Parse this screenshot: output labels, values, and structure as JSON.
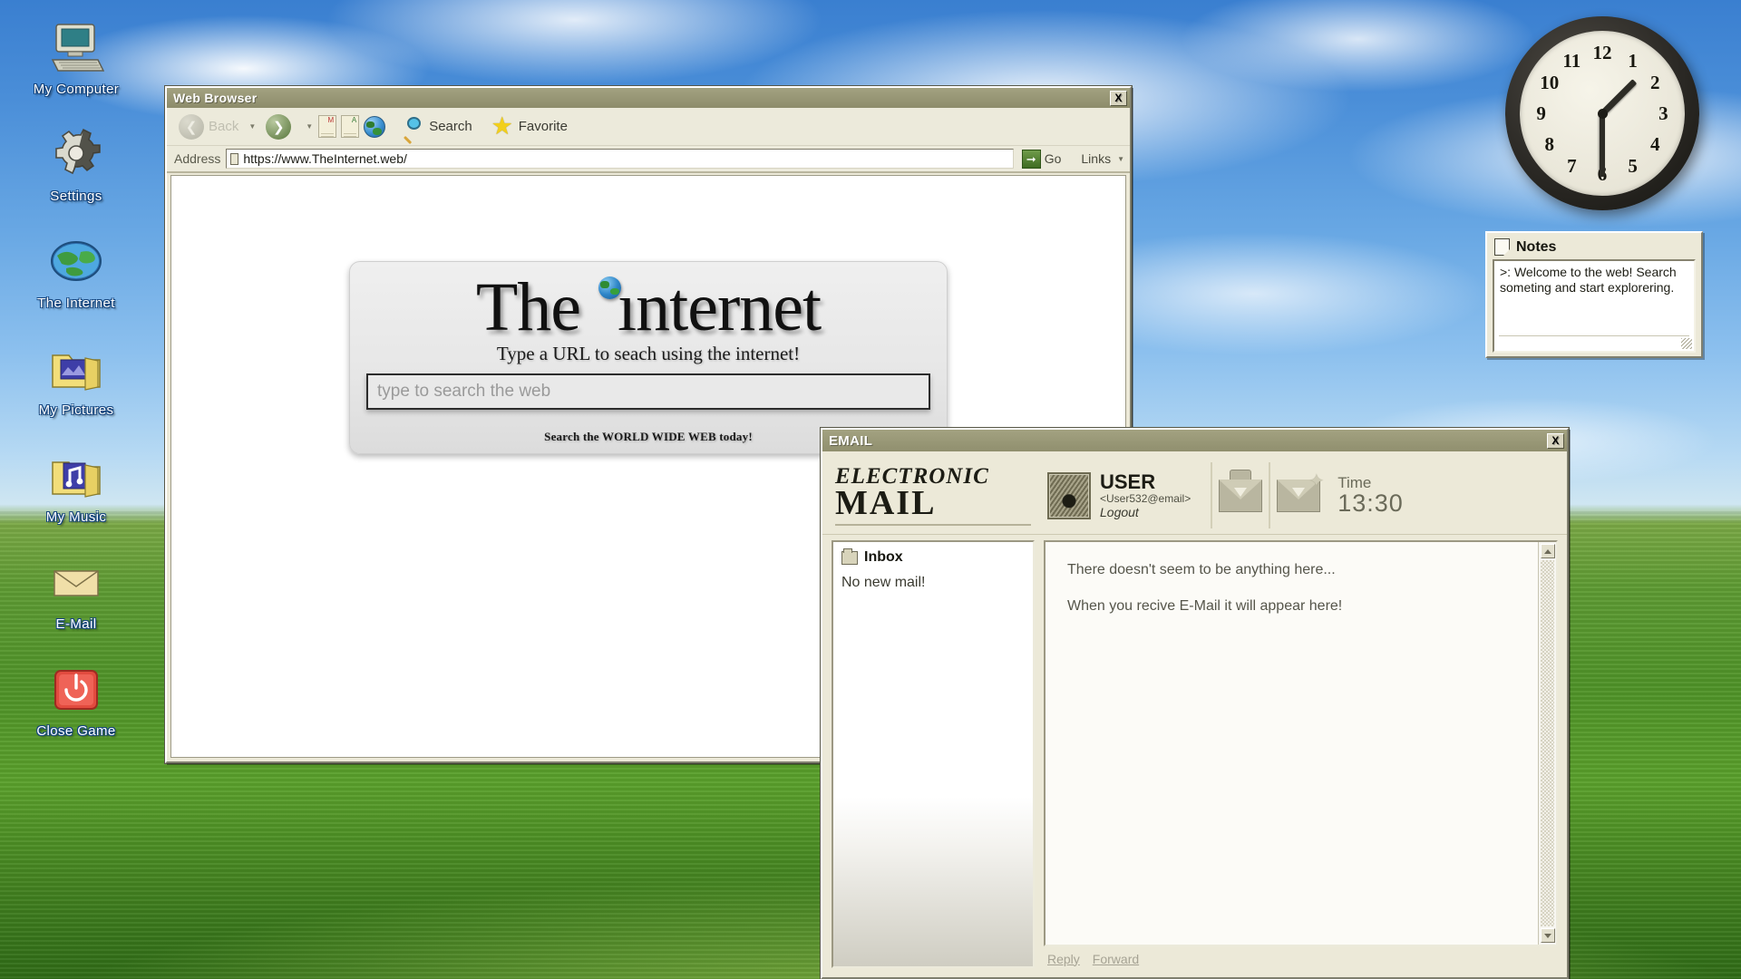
{
  "desktop": {
    "icons": [
      {
        "label": "My Computer",
        "icon": "computer-icon"
      },
      {
        "label": "Settings",
        "icon": "gear-icon"
      },
      {
        "label": "The Internet",
        "icon": "globe-icon"
      },
      {
        "label": "My Pictures",
        "icon": "pictures-folder-icon"
      },
      {
        "label": "My Music",
        "icon": "music-folder-icon"
      },
      {
        "label": "E-Mail",
        "icon": "envelope-icon"
      },
      {
        "label": "Close Game",
        "icon": "power-icon"
      }
    ]
  },
  "browser": {
    "title": "Web Browser",
    "close_label": "X",
    "toolbar": {
      "back_label": "Back",
      "forward_label": "",
      "search_label": "Search",
      "favorite_label": "Favorite",
      "page_mark_1": "M",
      "page_mark_2": "A"
    },
    "address": {
      "label": "Address",
      "value": "https://www.TheInternet.web/",
      "go_label": "Go",
      "go_glyph": "⮕",
      "links_label": "Links"
    },
    "page": {
      "brand_word_1": "The",
      "brand_word_2_head": "",
      "brand_word_2_tail": "nternet",
      "tagline": "Type a URL to seach using the internet!",
      "search_placeholder": "type to search the web",
      "footer": "Search the WORLD WIDE WEB today!"
    }
  },
  "email": {
    "title": "EMAIL",
    "close_label": "X",
    "logo_line_1": "ELECTRONIC",
    "logo_line_2": "MAIL",
    "user": {
      "name": "USER",
      "address": "<User532@email>",
      "logout_label": "Logout"
    },
    "time": {
      "label": "Time",
      "value": "13:30"
    },
    "inbox": {
      "title": "Inbox",
      "empty_text": "No new mail!"
    },
    "reading_pane": {
      "line_1": "There doesn't seem to be anything here...",
      "line_2": "When you recive E-Mail it will appear here!"
    },
    "actions": {
      "reply_label": "Reply",
      "forward_label": "Forward"
    }
  },
  "notes": {
    "title": "Notes",
    "text": ">: Welcome to the web! Search someting and start explorering."
  },
  "clock": {
    "numbers": [
      "12",
      "1",
      "2",
      "3",
      "4",
      "5",
      "6",
      "7",
      "8",
      "9",
      "10",
      "11"
    ],
    "hour_angle": 45,
    "minute_angle": 180
  },
  "colors": {
    "title_bar": "#9a9a78",
    "window_face": "#ece9d8",
    "accent_green": "#4f8a2a",
    "star_yellow": "#f2cf1b"
  }
}
